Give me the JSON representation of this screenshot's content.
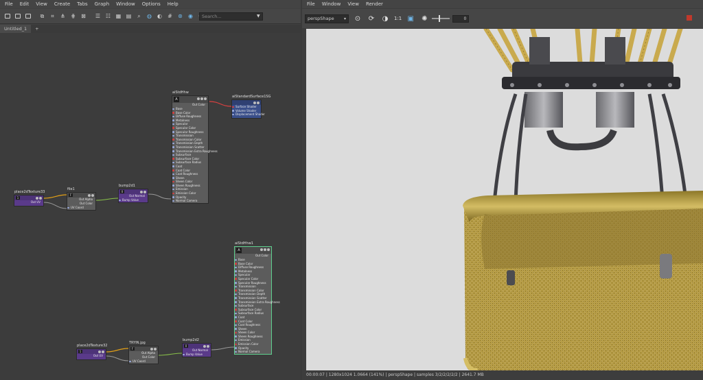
{
  "left_menu": [
    "File",
    "Edit",
    "View",
    "Create",
    "Tabs",
    "Graph",
    "Window",
    "Options",
    "Help"
  ],
  "search": {
    "placeholder": "Search..."
  },
  "tabs": [
    "Untitled_1",
    "+"
  ],
  "nodes": {
    "aiStd1": {
      "title": "aiStdHhw",
      "out": "Out Color",
      "attrs": [
        "Base",
        "Base Color",
        "Diffuse Roughness",
        "Metalness",
        "Specular",
        "Specular Color",
        "Specular Roughness",
        "Transmission",
        "Transmission Color",
        "Transmission Depth",
        "Transmission Scatter",
        "Transmission Extra Roughness",
        "Subsurface",
        "Subsurface Color",
        "Subsurface Radius",
        "Coat",
        "Coat Color",
        "Coat Roughness",
        "Sheen",
        "Sheen Color",
        "Sheen Roughness",
        "Emission",
        "Emission Color",
        "Opacity",
        "Normal Camera"
      ]
    },
    "sg1": {
      "title": "aiStandardSurface1SG",
      "attrs": [
        "Surface Shader",
        "Volume Shader",
        "Displacement Shader"
      ]
    },
    "place1": {
      "title": "place2dTexture33",
      "val": "1",
      "out": "Out UV"
    },
    "file1": {
      "title": "file1",
      "outs": [
        "Out Alpha",
        "Out Color"
      ],
      "in": "UV Coord"
    },
    "bump1": {
      "title": "bump2d1",
      "val": "0",
      "out": "Out Normal",
      "in": "Bump Value"
    },
    "aiStd2": {
      "title": "aiStdHhw1",
      "out": "Out Color",
      "attrs": [
        "Base",
        "Base Color",
        "Diffuse Roughness",
        "Metalness",
        "Specular",
        "Specular Color",
        "Specular Roughness",
        "Transmission",
        "Transmission Color",
        "Transmission Depth",
        "Transmission Scatter",
        "Transmission Extra Roughness",
        "Subsurface",
        "Subsurface Color",
        "Subsurface Radius",
        "Coat",
        "Coat Color",
        "Coat Roughness",
        "Sheen",
        "Sheen Color",
        "Sheen Roughness",
        "Emission",
        "Emission Color",
        "Opacity",
        "Normal Camera"
      ]
    },
    "place2": {
      "title": "place2dTexture32",
      "val": "1",
      "out": "Out UV"
    },
    "file2": {
      "title": "TRYIN.jpg",
      "outs": [
        "Out Alpha",
        "Out Color"
      ],
      "in": "UV Coord"
    },
    "bump2": {
      "title": "bump2d2",
      "val": "0",
      "out": "Out Normal",
      "in": "Bump Value"
    }
  },
  "right_menu": [
    "File",
    "Window",
    "View",
    "Render"
  ],
  "render": {
    "camera": "perspShape",
    "ratio": "1:1",
    "exposure": "0",
    "status": "00:00:07 | 1280x1024 1.0664 (141%) | perspShape | samples 3/2/2/2/2/2 | 2641.7 MB"
  },
  "colors": {
    "rope": "#c9aa4e",
    "basket": "#b49a3e",
    "metal": "#4a4a4e",
    "bg": "#dcdcdc"
  }
}
